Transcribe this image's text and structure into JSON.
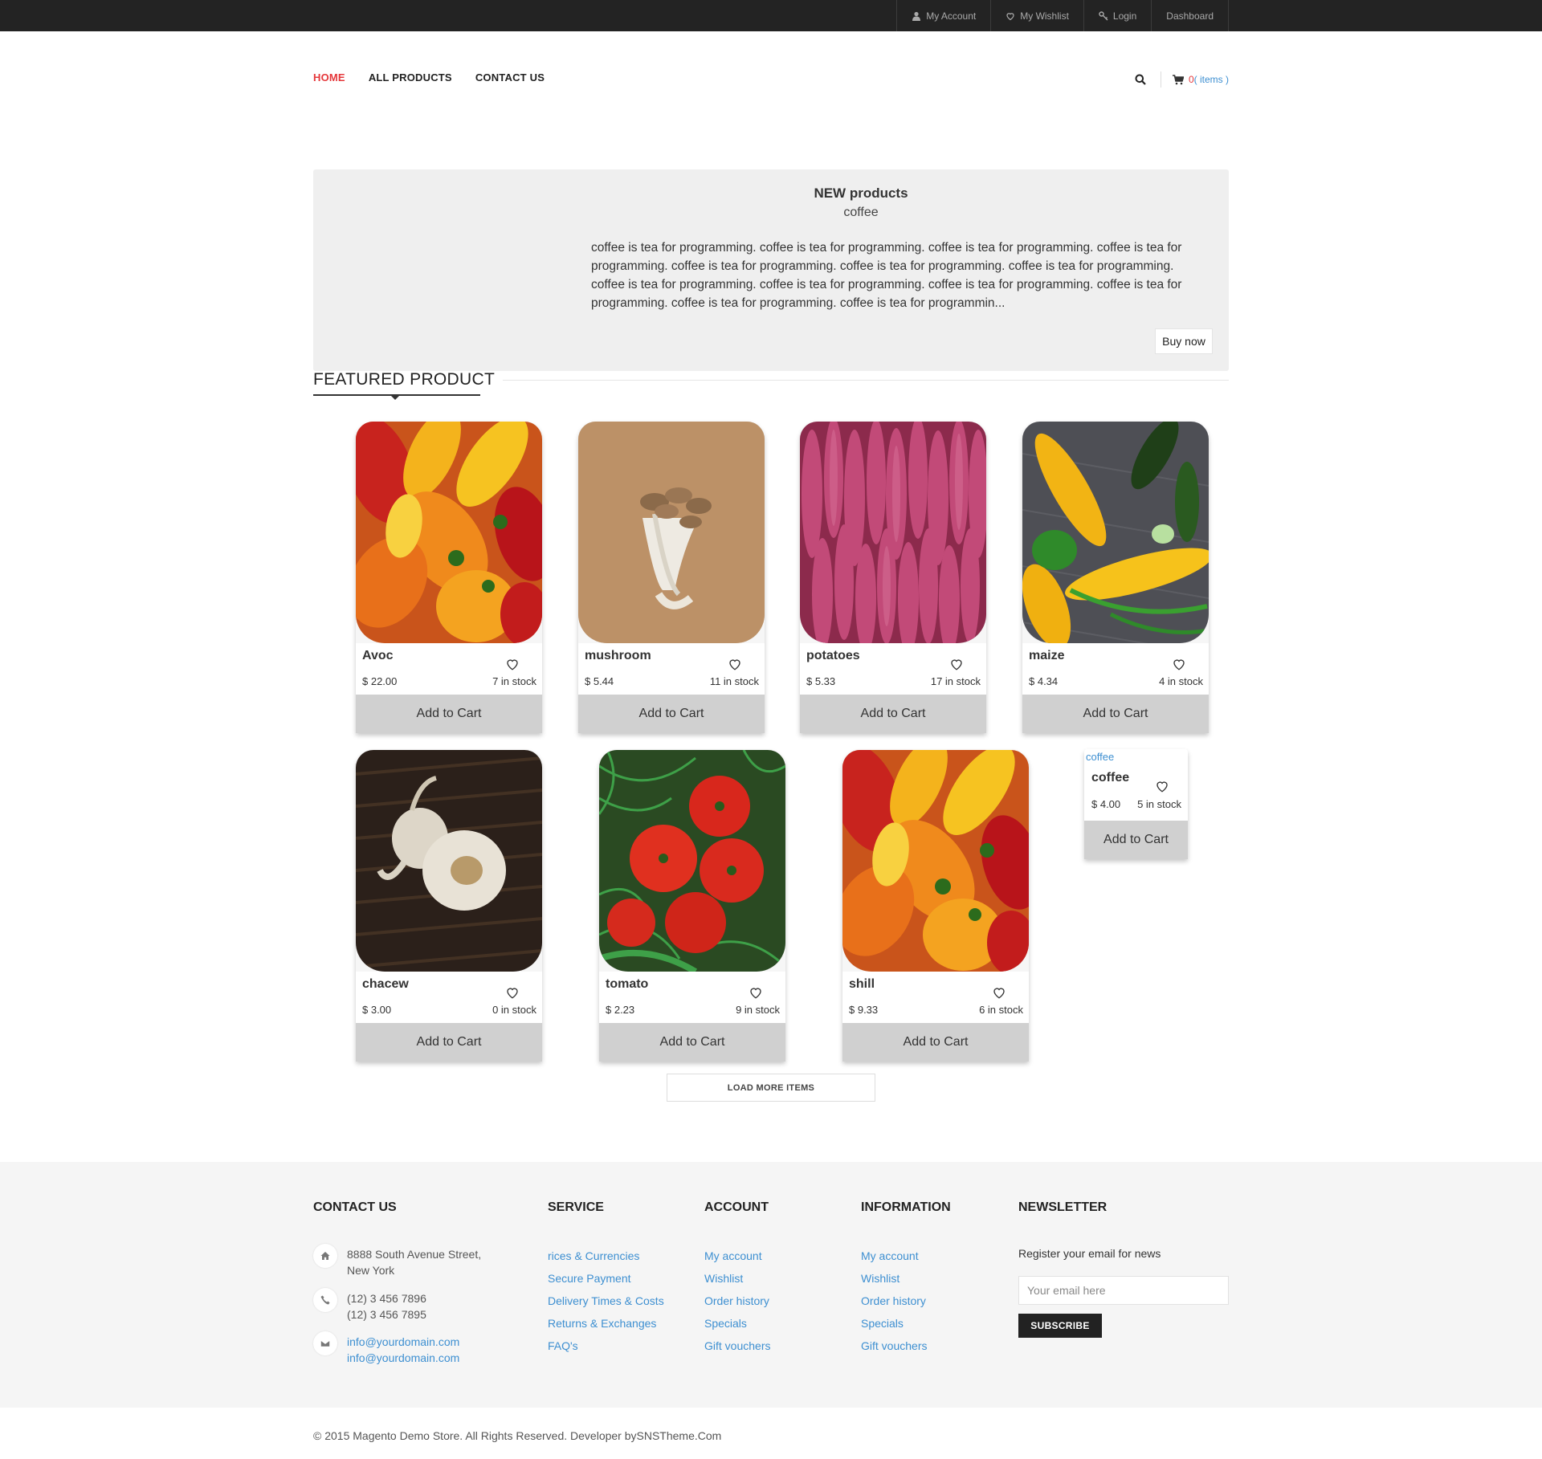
{
  "topbar": {
    "links": [
      {
        "label": "My Account",
        "icon": "user-icon"
      },
      {
        "label": "My Wishlist",
        "icon": "heart-icon"
      },
      {
        "label": "Login",
        "icon": "key-icon"
      },
      {
        "label": "Dashboard",
        "icon": ""
      }
    ]
  },
  "nav": {
    "items": [
      "HOME",
      "ALL PRODUCTS",
      "CONTACT US"
    ],
    "active": "HOME"
  },
  "cart": {
    "count": "0",
    "items_label": "( items )"
  },
  "hero": {
    "title": "NEW products",
    "subtitle": "coffee",
    "description": "coffee is tea for programming. coffee is tea for programming. coffee is tea for programming. coffee is tea for programming. coffee is tea for programming. coffee is tea for programming. coffee is tea for programming. coffee is tea for programming. coffee is tea for programming. coffee is tea for programming. coffee is tea for programming. coffee is tea for programming. coffee is tea for programmin...",
    "button": "Buy now"
  },
  "featured": {
    "title": "FEATURED PRODUCT"
  },
  "products": [
    {
      "name": "Avoc",
      "price": "$ 22.00",
      "stock": "7 in stock",
      "image": "peppers"
    },
    {
      "name": "mushroom",
      "price": "$ 5.44",
      "stock": "11 in stock",
      "image": "mushroom"
    },
    {
      "name": "potatoes",
      "price": "$ 5.33",
      "stock": "17 in stock",
      "image": "sweet-potatoes"
    },
    {
      "name": "maize",
      "price": "$ 4.34",
      "stock": "4 in stock",
      "image": "corn"
    },
    {
      "name": "chacew",
      "price": "$ 3.00",
      "stock": "0 in stock",
      "image": "garlic"
    },
    {
      "name": "tomato",
      "price": "$ 2.23",
      "stock": "9 in stock",
      "image": "tomatoes"
    },
    {
      "name": "shill",
      "price": "$ 9.33",
      "stock": "6 in stock",
      "image": "peppers"
    }
  ],
  "product_small": {
    "alt": "coffee",
    "name": "coffee",
    "price": "$ 4.00",
    "stock": "5 in stock"
  },
  "add_to_cart": "Add to Cart",
  "load_more": "LOAD MORE ITEMS",
  "footer": {
    "contact": {
      "title": "CONTACT US",
      "address": [
        "8888 South Avenue Street,",
        "New York"
      ],
      "phones": [
        "(12) 3 456 7896",
        "(12) 3 456 7895"
      ],
      "emails": [
        "info@yourdomain.com",
        "info@yourdomain.com"
      ]
    },
    "service": {
      "title": "SERVICE",
      "links": [
        "rices & Currencies",
        "Secure Payment",
        "Delivery Times & Costs",
        "Returns & Exchanges",
        "FAQ's"
      ]
    },
    "account": {
      "title": "ACCOUNT",
      "links": [
        "My account",
        "Wishlist",
        "Order history",
        "Specials",
        "Gift vouchers"
      ]
    },
    "information": {
      "title": "INFORMATION",
      "links": [
        "My account",
        "Wishlist",
        "Order history",
        "Specials",
        "Gift vouchers"
      ]
    },
    "newsletter": {
      "title": "NEWSLETTER",
      "text": "Register your email for news",
      "placeholder": "Your email here",
      "button": "SUBSCRIBE"
    }
  },
  "copyright": "© 2015 Magento Demo Store. All Rights Reserved. Developer bySNSTheme.Com",
  "colors": {
    "accent": "#e5383b",
    "link": "#3d8fd1",
    "topbar": "#232323"
  }
}
